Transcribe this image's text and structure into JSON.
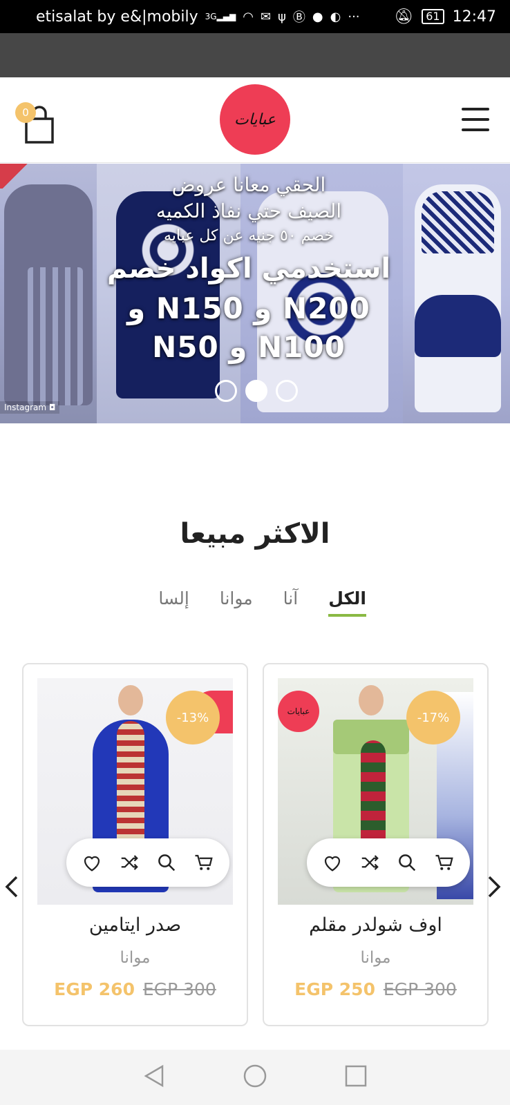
{
  "status_bar": {
    "carrier": "etisalat by e&|mobily",
    "network": "3G",
    "battery": "61",
    "time": "12:47"
  },
  "header": {
    "cart_count": "0",
    "logo_text": "عبايات",
    "cart_icon": "shopping-bag-icon",
    "menu_icon": "hamburger-icon"
  },
  "hero": {
    "line1": "الحقي معانا عروض",
    "line2": "الصيف حتي نفاذ الكميه",
    "line3": "خصم ٥٠ جنيه عن كل عبايه",
    "line4": "استخدمي اكواد خصم",
    "line5": "N200 و N150 و N100 و N50",
    "instagram": "Instagram",
    "slides": 3,
    "active_slide": 2
  },
  "section": {
    "title": "الاكثر مبيعا",
    "tabs": [
      "الكل",
      "آنا",
      "موانا",
      "إلسا"
    ],
    "active_tab": 0
  },
  "products": [
    {
      "name": "اوف شولدر مقلم",
      "brand": "موانا",
      "price_now": "EGP 250",
      "price_old": "EGP 300",
      "discount": "-17%",
      "badge_logo": "عبايات"
    },
    {
      "name": "صدر ايتامين",
      "brand": "موانا",
      "price_now": "EGP 260",
      "price_old": "EGP 300",
      "discount": "-13%"
    }
  ],
  "colors": {
    "accent_yellow": "#f4c36b",
    "brand_red": "#ee3d55",
    "tab_underline": "#8ab944"
  }
}
